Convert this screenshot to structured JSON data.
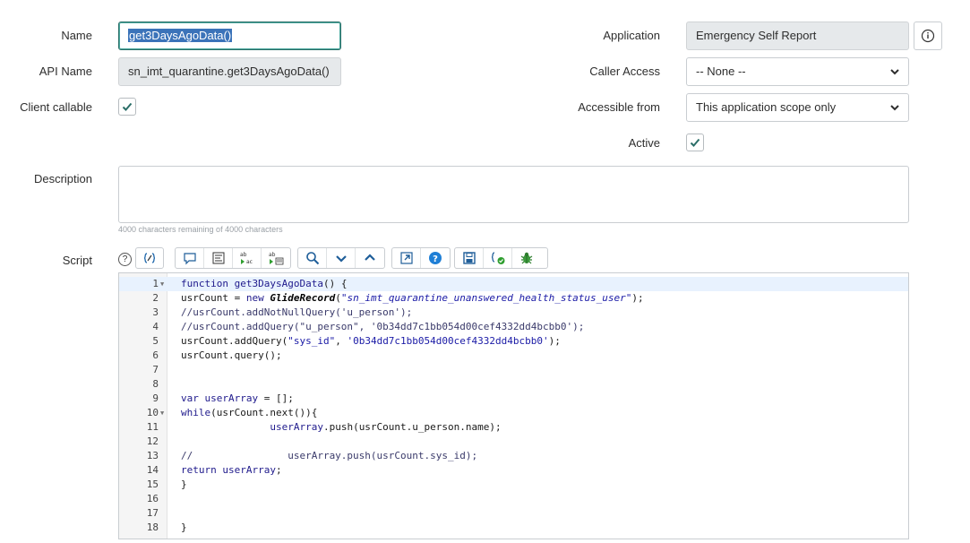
{
  "form": {
    "name_label": "Name",
    "name_value": "get3DaysAgoData()",
    "api_name_label": "API Name",
    "api_name_value": "sn_imt_quarantine.get3DaysAgoData()",
    "client_callable_label": "Client callable",
    "client_callable_checked": true,
    "application_label": "Application",
    "application_value": "Emergency Self Report",
    "caller_access_label": "Caller Access",
    "caller_access_value": "-- None --",
    "accessible_from_label": "Accessible from",
    "accessible_from_value": "This application scope only",
    "active_label": "Active",
    "active_checked": true,
    "description_label": "Description",
    "description_value": "",
    "description_hint": "4000 characters remaining of 4000 characters",
    "script_label": "Script",
    "help_glyph": "?"
  },
  "toolbar": {
    "groups": [
      [
        "format-code-icon"
      ],
      [
        "comment-icon",
        "format-icon",
        "replace-icon",
        "replace-all-icon"
      ],
      [
        "search-icon",
        "next-icon",
        "previous-icon"
      ],
      [
        "fullscreen-icon",
        "help-icon"
      ],
      [
        "save-icon",
        "check-syntax-icon",
        "debug-icon"
      ]
    ]
  },
  "editor": {
    "lines": [
      {
        "n": "1",
        "fold": true,
        "html": "<span class=\"kw\">function</span> <span class=\"fn\">get3DaysAgoData</span>() {"
      },
      {
        "n": "2",
        "fold": false,
        "html": "usrCount = <span class=\"kw\">new</span> <span class=\"cls\">GlideRecord</span>(<span class=\"strit\">\"sn_imt_quarantine_unanswered_health_status_user\"</span>);"
      },
      {
        "n": "3",
        "fold": false,
        "html": "<span class=\"cmt\">//usrCount.addNotNullQuery('u_person');</span>"
      },
      {
        "n": "4",
        "fold": false,
        "html": "<span class=\"cmt\">//usrCount.addQuery(\"u_person\", '0b34dd7c1bb054d00cef4332dd4bcbb0');</span>"
      },
      {
        "n": "5",
        "fold": false,
        "html": "usrCount.addQuery(<span class=\"str\">\"sys_id\"</span>, <span class=\"str\">'0b34dd7c1bb054d00cef4332dd4bcbb0'</span>);"
      },
      {
        "n": "6",
        "fold": false,
        "html": "usrCount.query();"
      },
      {
        "n": "7",
        "fold": false,
        "html": ""
      },
      {
        "n": "8",
        "fold": false,
        "html": ""
      },
      {
        "n": "9",
        "fold": false,
        "html": "<span class=\"kw\">var</span> <span class=\"fn\">userArray</span> = [];"
      },
      {
        "n": "10",
        "fold": true,
        "html": "<span class=\"kw\">while</span>(usrCount.next()){"
      },
      {
        "n": "11",
        "fold": false,
        "html": "               <span class=\"fn\">userArray</span>.push(usrCount.u_person.name);"
      },
      {
        "n": "12",
        "fold": false,
        "html": ""
      },
      {
        "n": "13",
        "fold": false,
        "html": "<span class=\"cmt\">//                userArray.push(usrCount.sys_id);</span>"
      },
      {
        "n": "14",
        "fold": false,
        "html": "<span class=\"kw\">return</span> <span class=\"fn\">userArray</span>;"
      },
      {
        "n": "15",
        "fold": false,
        "html": "}"
      },
      {
        "n": "16",
        "fold": false,
        "html": ""
      },
      {
        "n": "17",
        "fold": false,
        "html": ""
      },
      {
        "n": "18",
        "fold": false,
        "html": "}"
      }
    ]
  },
  "colors": {
    "accent": "#2b6e68",
    "selection": "#3b73b9",
    "help_blue": "#1f7fd6"
  }
}
